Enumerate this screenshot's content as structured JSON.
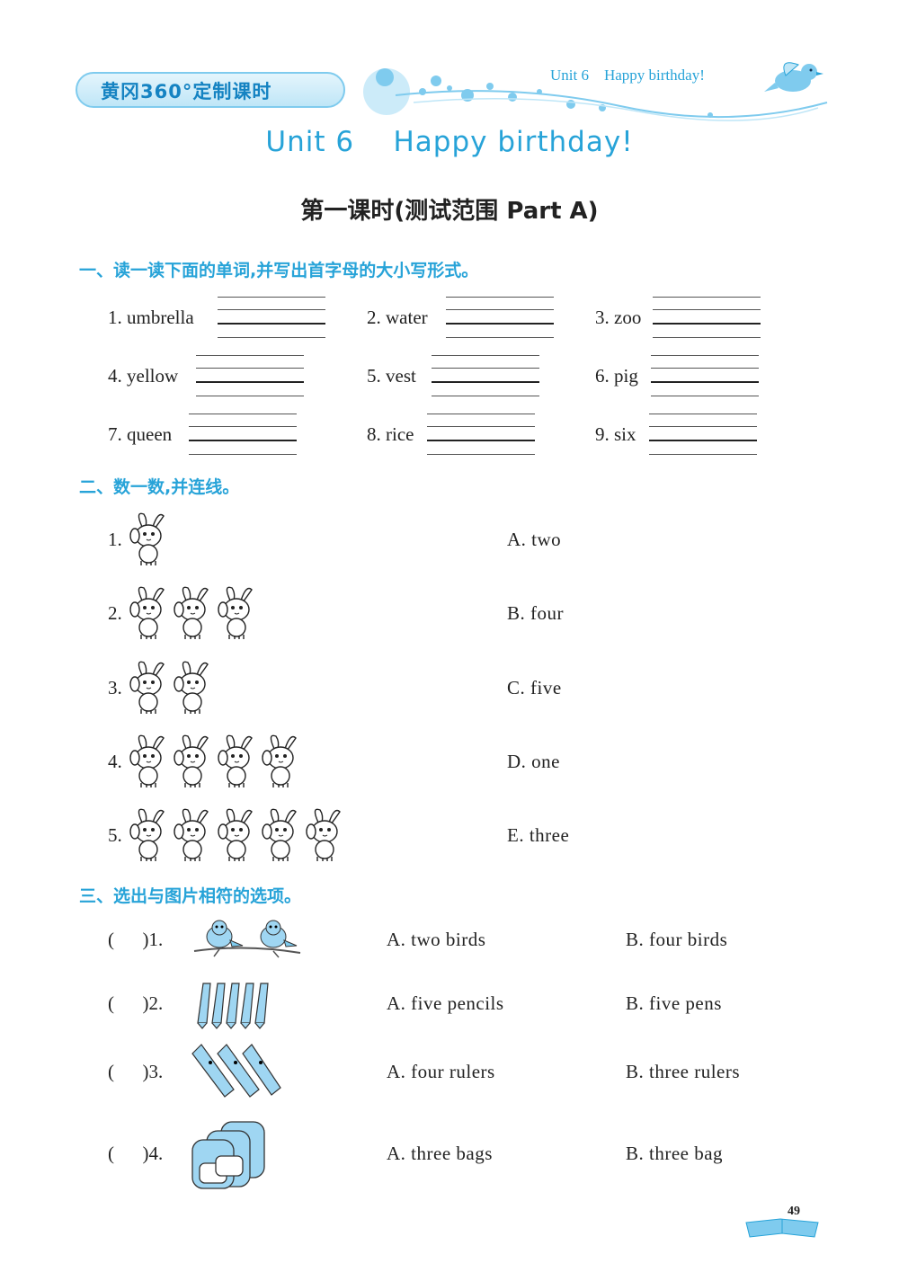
{
  "header": {
    "series": "黄冈360°定制课时",
    "unit_label": "Unit 6    Happy birthday!"
  },
  "title": {
    "unit": "Unit 6    Happy birthday!",
    "lesson": "第一课时(测试范围 Part A)"
  },
  "part1": {
    "heading": "一、读一读下面的单词,并写出首字母的大小写形式。",
    "words": [
      "1. umbrella",
      "2. water",
      "3. zoo",
      "4. yellow",
      "5. vest",
      "6. pig",
      "7. queen",
      "8. rice",
      "9. six"
    ]
  },
  "part2": {
    "heading": "二、数一数,并连线。",
    "items": [
      {
        "number": "1.",
        "count": 1
      },
      {
        "number": "2.",
        "count": 3
      },
      {
        "number": "3.",
        "count": 2
      },
      {
        "number": "4.",
        "count": 4
      },
      {
        "number": "5.",
        "count": 5
      }
    ],
    "options": [
      "A. two",
      "B. four",
      "C. five",
      "D. one",
      "E. three"
    ]
  },
  "part3": {
    "heading": "三、选出与图片相符的选项。",
    "questions": [
      {
        "paren": "(      )1.",
        "picture": "two-birds-icon",
        "a": "A. two birds",
        "b": "B. four birds"
      },
      {
        "paren": "(      )2.",
        "picture": "five-pens-icon",
        "a": "A. five pencils",
        "b": "B. five pens"
      },
      {
        "paren": "(      )3.",
        "picture": "three-rulers-icon",
        "a": "A. four rulers",
        "b": "B. three rulers"
      },
      {
        "paren": "(      )4.",
        "picture": "three-bags-icon",
        "a": "A. three bags",
        "b": "B. three bag"
      }
    ]
  },
  "footer": {
    "page_number": "49"
  },
  "colors": {
    "accent": "#27a3d8",
    "light": "#bfe6f7"
  }
}
